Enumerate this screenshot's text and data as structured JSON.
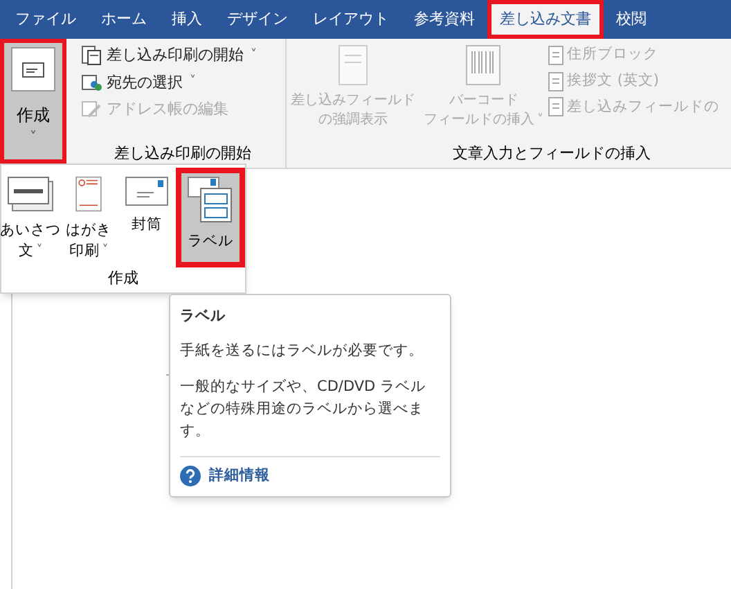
{
  "tabs": [
    {
      "label": "ファイル",
      "selected": false,
      "highlighted": false
    },
    {
      "label": "ホーム",
      "selected": false,
      "highlighted": false
    },
    {
      "label": "挿入",
      "selected": false,
      "highlighted": false
    },
    {
      "label": "デザイン",
      "selected": false,
      "highlighted": false
    },
    {
      "label": "レイアウト",
      "selected": false,
      "highlighted": false
    },
    {
      "label": "参考資料",
      "selected": false,
      "highlighted": false
    },
    {
      "label": "差し込み文書",
      "selected": true,
      "highlighted": true
    },
    {
      "label": "校閲",
      "selected": false,
      "highlighted": false
    }
  ],
  "create_button": {
    "label": "作成",
    "caret": "˅",
    "pressed": true,
    "highlighted": true
  },
  "start_group": {
    "items": [
      {
        "label": "差し込み印刷の開始",
        "caret": "˅",
        "disabled": false
      },
      {
        "label": "宛先の選択",
        "caret": "˅",
        "disabled": false
      },
      {
        "label": "アドレス帳の編集",
        "disabled": true
      }
    ],
    "label": "差し込み印刷の開始"
  },
  "insert_group": {
    "large_buttons": [
      {
        "lines": [
          "差し込みフィールド",
          "の強調表示"
        ],
        "disabled": true
      },
      {
        "lines": [
          "バーコード",
          "フィールドの挿入"
        ],
        "caret": "˅",
        "disabled": true
      }
    ],
    "small_buttons": [
      {
        "label": "住所ブロック",
        "disabled": true
      },
      {
        "label": "挨拶文 (英文)",
        "disabled": true
      },
      {
        "label": "差し込みフィールドの",
        "disabled": true
      }
    ],
    "label": "文章入力とフィールドの挿入"
  },
  "create_menu": {
    "items": [
      {
        "kind": "greeting",
        "lines": [
          "あいさつ",
          "文"
        ],
        "caret": "˅",
        "selected": false,
        "highlighted": false
      },
      {
        "kind": "postcard",
        "lines": [
          "はがき",
          "印刷"
        ],
        "caret": "˅",
        "selected": false,
        "highlighted": false
      },
      {
        "kind": "envelope",
        "lines": [
          "封筒"
        ],
        "selected": false,
        "highlighted": false
      },
      {
        "kind": "label",
        "lines": [
          "ラベル"
        ],
        "selected": true,
        "highlighted": true
      }
    ],
    "label": "作成"
  },
  "tooltip": {
    "title": "ラベル",
    "paragraphs": [
      "手紙を送るにはラベルが必要です。",
      "一般的なサイズや、CD/DVD ラベルなどの特殊用途のラベルから選べます。"
    ],
    "link": "詳細情報"
  }
}
